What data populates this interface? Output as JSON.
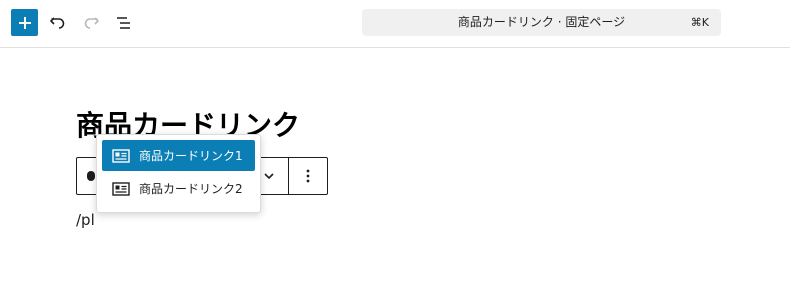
{
  "toolbar": {
    "add_icon": "plus-icon",
    "undo_icon": "undo-icon",
    "redo_icon": "redo-icon",
    "outline_icon": "list-view-icon"
  },
  "command_bar": {
    "title": "商品カードリンク · 固定ページ",
    "shortcut": "⌘K"
  },
  "page": {
    "title": "商品カードリンク"
  },
  "block_toolbar": {
    "chevron_icon": "chevron-down-icon",
    "more_icon": "more-vertical-icon"
  },
  "autocomplete": {
    "items": [
      {
        "label": "商品カードリンク1",
        "icon": "card-block-icon",
        "selected": true
      },
      {
        "label": "商品カードリンク2",
        "icon": "card-block-icon",
        "selected": false
      }
    ]
  },
  "editor": {
    "paragraph_text": "/pl"
  },
  "colors": {
    "accent": "#0b7fb5",
    "command_bg": "#f0f0f0",
    "text": "#1e1e1e"
  }
}
